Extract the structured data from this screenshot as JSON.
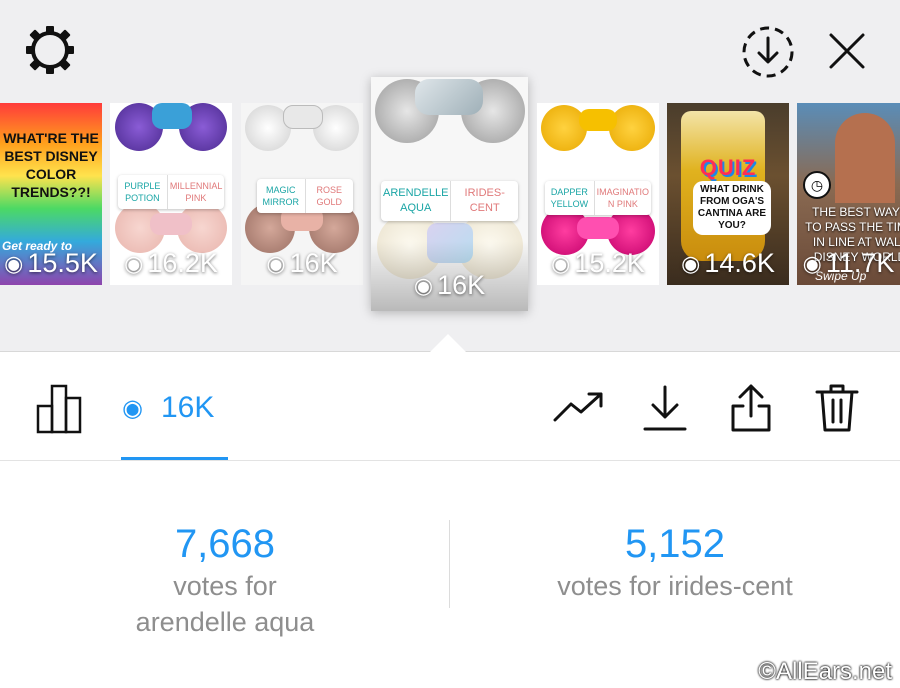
{
  "header": {
    "settings_icon": "gear-icon",
    "save_icon": "download-circle-icon",
    "close_icon": "close-icon"
  },
  "stories": [
    {
      "views": "15.5K",
      "headline": "WHAT'RE THE BEST DISNEY COLOR TRENDS??!",
      "footer": "Get ready to"
    },
    {
      "views": "16.2K",
      "poll": [
        "PURPLE POTION",
        "MILLENNIAL PINK"
      ]
    },
    {
      "views": "16K",
      "poll": [
        "MAGIC MIRROR",
        "ROSE GOLD"
      ]
    },
    {
      "views": "16K",
      "poll": [
        "ARENDELLE AQUA",
        "IRIDES-CENT"
      ],
      "selected": true
    },
    {
      "views": "15.2K",
      "poll": [
        "DAPPER YELLOW",
        "IMAGINATIO N PINK"
      ]
    },
    {
      "views": "14.6K",
      "quiz_label": "QUIZ",
      "question": "WHAT DRINK FROM OGA'S CANTINA ARE YOU?"
    },
    {
      "views": "11.7K",
      "headline": "THE BEST WAYS TO PASS THE TIME IN LINE AT WALT DISNEY WORLD",
      "footer": "Swipe Up"
    }
  ],
  "toolbar": {
    "count": "16K",
    "icons": [
      "bar-chart-icon",
      "eye-icon",
      "trend-icon",
      "download-icon",
      "share-icon",
      "trash-icon"
    ]
  },
  "results": [
    {
      "value": "7,668",
      "label_line1": "votes for",
      "label_line2": "arendelle aqua"
    },
    {
      "value": "5,152",
      "label_line1": "votes for irides-cent"
    }
  ],
  "watermark": "©AllEars.net",
  "colors": {
    "accent": "#2196f3",
    "text_gray": "#8e8e8e",
    "top_bg": "#efeff1"
  }
}
